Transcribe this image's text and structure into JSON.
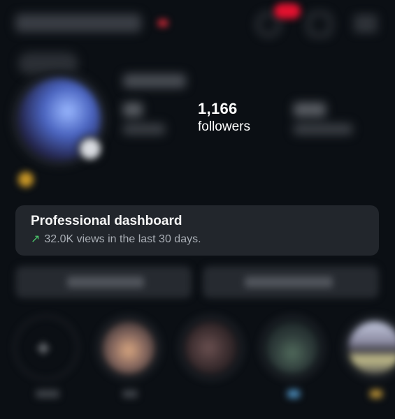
{
  "profile": {
    "followers_count": "1,166",
    "followers_label": "followers"
  },
  "dashboard": {
    "title": "Professional dashboard",
    "views_text": "32.0K views in the last 30 days.",
    "trend_icon": "↗",
    "trend_color": "#4cc66b"
  },
  "header": {
    "notification_badge_color": "#e3112f",
    "live_indicator_color": "#d52837"
  },
  "icons": {
    "threads": "threads-icon",
    "create": "plus-square-icon",
    "menu": "hamburger-menu-icon",
    "new_highlight": "plus-icon"
  },
  "highlights": {
    "new_symbol": "+"
  }
}
